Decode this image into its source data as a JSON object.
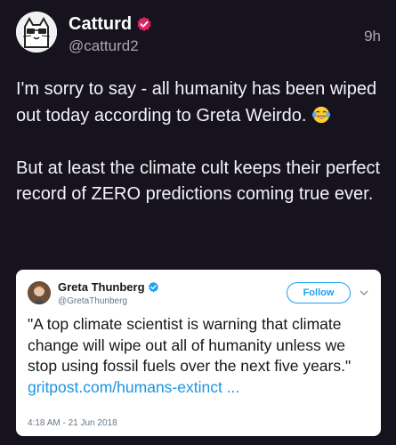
{
  "author": {
    "name": "Catturd",
    "handle": "@catturd2",
    "time": "9h"
  },
  "tweet": {
    "line1": "I'm sorry to say - all humanity has been wiped out today according to Greta Weirdo.",
    "line2": "But at least the climate cult keeps their perfect record of ZERO predictions coming true ever.",
    "emoji": "face-with-tears-of-joy-icon"
  },
  "quoted": {
    "name": "Greta Thunberg",
    "handle": "@GretaThunberg",
    "follow_label": "Follow",
    "text": "\"A top climate scientist is warning that climate change will wipe out all of humanity unless we stop using fossil fuels over the next five years.\"",
    "link": "gritpost.com/humans-extinct ...",
    "timestamp": "4:18 AM - 21 Jun 2018"
  },
  "colors": {
    "background": "#16131f",
    "verified": "#e0245e",
    "quoted_verified": "#1da1f2",
    "link": "#1b95e0"
  }
}
